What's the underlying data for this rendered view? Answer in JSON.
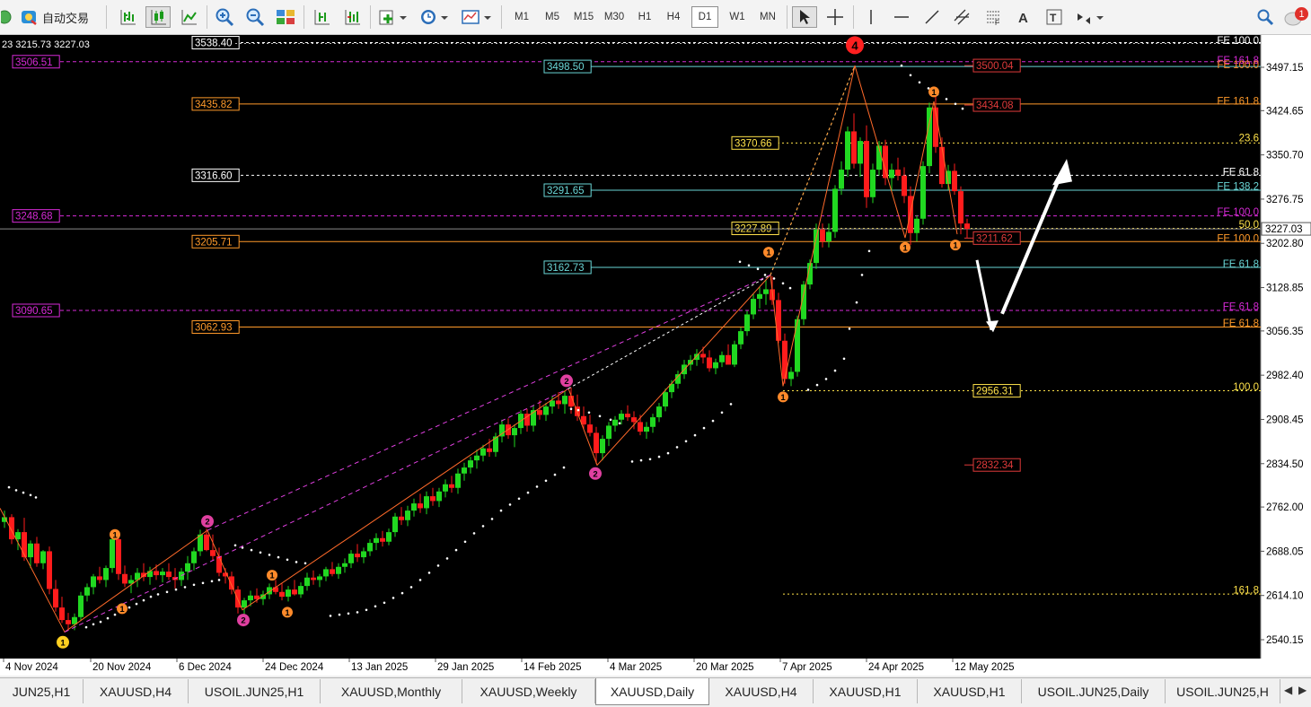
{
  "toolbar": {
    "autotrade_label": "自动交易",
    "timeframes": [
      "M1",
      "M5",
      "M15",
      "M30",
      "H1",
      "H4",
      "D1",
      "W1",
      "MN"
    ],
    "active_timeframe": "D1",
    "notification_count": "1"
  },
  "chart": {
    "symbol_info": "23 3215.73 3227.03",
    "colors": {
      "bull": "#21d821",
      "bear": "#ff1c1c",
      "background": "#000000"
    },
    "price_axis": [
      "3497.15",
      "3424.65",
      "3350.70",
      "3276.75",
      "3202.80",
      "3128.85",
      "3056.35",
      "2982.40",
      "2908.45",
      "2834.50",
      "2762.00",
      "2688.05",
      "2614.10",
      "2540.15"
    ],
    "current_price": "3227.03",
    "date_axis": [
      "4 Nov 2024",
      "20 Nov 2024",
      "6 Dec 2024",
      "24 Dec 2024",
      "13 Jan 2025",
      "29 Jan 2025",
      "14 Feb 2025",
      "4 Mar 2025",
      "20 Mar 2025",
      "7 Apr 2025",
      "24 Apr 2025",
      "12 May 2025"
    ],
    "level_boxes": {
      "magenta": [
        "3506.51",
        "3248.68",
        "3090.65"
      ],
      "orange": [
        "3435.82",
        "3205.71",
        "3062.93"
      ],
      "white": [
        "3538.40",
        "3316.60"
      ],
      "cyan": [
        "3498.50",
        "3291.65",
        "3162.73"
      ],
      "yellow": [
        "3370.66",
        "3227.89",
        "2956.31"
      ],
      "red": [
        "3500.04",
        "3434.08",
        "3211.62",
        "2832.34"
      ]
    },
    "fib_labels": [
      "FE 100.0",
      "FE 161.8",
      "FE 100.0",
      "FE 161.8",
      "23.6",
      "FE 61.8",
      "FE 138.2",
      "FE 100.0",
      "50.0",
      "FE 100.0",
      "FE 61.8",
      "FE 61.8",
      "FE 61.8",
      "100.0",
      "161.8"
    ],
    "wave_labels": [
      "1",
      "1",
      "2",
      "2",
      "1",
      "1",
      "1",
      "2",
      "2",
      "1",
      "1",
      "4",
      "1",
      "1",
      "1"
    ]
  },
  "tabs": [
    "JUN25,H1",
    "XAUUSD,H4",
    "USOIL.JUN25,H1",
    "XAUUSD,Monthly",
    "XAUUSD,Weekly",
    "XAUUSD,Daily",
    "XAUUSD,H4",
    "XAUUSD,H1",
    "XAUUSD,H1",
    "USOIL.JUN25,Daily",
    "USOIL.JUN25,H"
  ],
  "active_tab": "XAUUSD,Daily"
}
